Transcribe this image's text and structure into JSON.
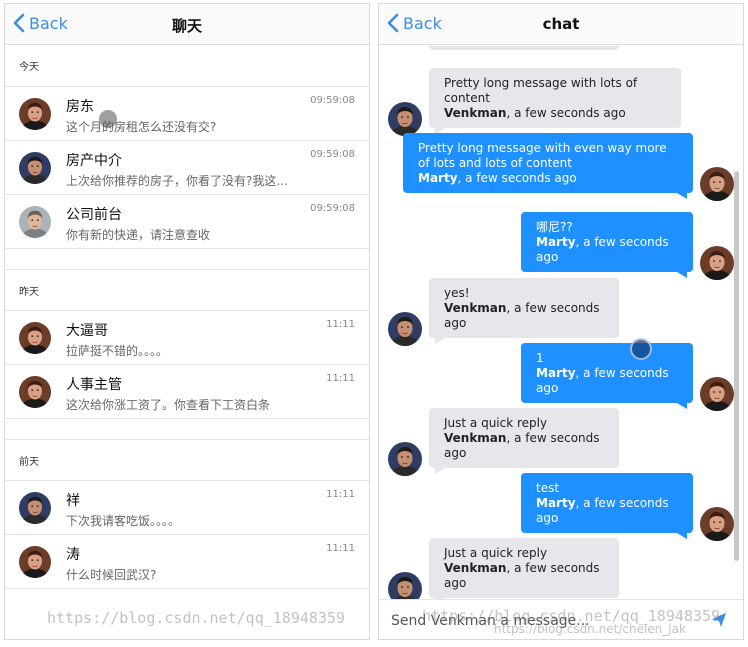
{
  "left_panel": {
    "back_label": "Back",
    "title": "聊天",
    "sections": [
      {
        "label": "今天",
        "items": [
          {
            "name": "房东",
            "preview": "这个月的房租怎么还没有交?",
            "time": "09:59:08"
          },
          {
            "name": "房产中介",
            "preview": "上次给你推荐的房子，你看了没有?我这...",
            "time": "09:59:08"
          },
          {
            "name": "公司前台",
            "preview": "你有新的快递，请注意查收",
            "time": "09:59:08"
          }
        ]
      },
      {
        "label": "昨天",
        "items": [
          {
            "name": "大逼哥",
            "preview": "拉萨挺不错的。。。。",
            "time": "11:11"
          },
          {
            "name": "人事主管",
            "preview": "这次给你涨工资了。你查看下工资白条",
            "time": "11:11"
          }
        ]
      },
      {
        "label": "前天",
        "items": [
          {
            "name": "祥",
            "preview": "下次我请客吃饭。。。。",
            "time": "11:11"
          },
          {
            "name": "涛",
            "preview": "什么时候回武汉?",
            "time": "11:11"
          }
        ]
      }
    ]
  },
  "right_panel": {
    "back_label": "Back",
    "title": "chat",
    "messages": [
      {
        "side": "left",
        "text": "Pretty long message with lots of content",
        "author": "Venkman",
        "time": "a few seconds ago"
      },
      {
        "side": "right",
        "text": "Pretty long message with even way more of lots and lots of content",
        "author": "Marty",
        "time": "a few seconds ago"
      },
      {
        "side": "right",
        "text": "哪尼??",
        "author": "Marty",
        "time": "a few seconds ago"
      },
      {
        "side": "left",
        "text": "yes!",
        "author": "Venkman",
        "time": "a few seconds ago"
      },
      {
        "side": "right",
        "text": "1",
        "author": "Marty",
        "time": "a few seconds ago"
      },
      {
        "side": "left",
        "text": "Just a quick reply",
        "author": "Venkman",
        "time": "a few seconds ago"
      },
      {
        "side": "right",
        "text": "test",
        "author": "Marty",
        "time": "a few seconds ago"
      },
      {
        "side": "left",
        "text": "Just a quick reply",
        "author": "Venkman",
        "time": "a few seconds ago"
      }
    ],
    "composer_placeholder": "Send Venkman a message..."
  },
  "watermarks": {
    "left": "https://blog.csdn.net/qq_18948359",
    "right": "https://blog.csdn.net/qq_18948359",
    "bottom": "https://blog.csdn.net/chelen_jak"
  },
  "colors": {
    "accent": "#3a8ee6",
    "bubble_incoming": "#e6e6eb",
    "bubble_outgoing": "#1e90ff"
  }
}
